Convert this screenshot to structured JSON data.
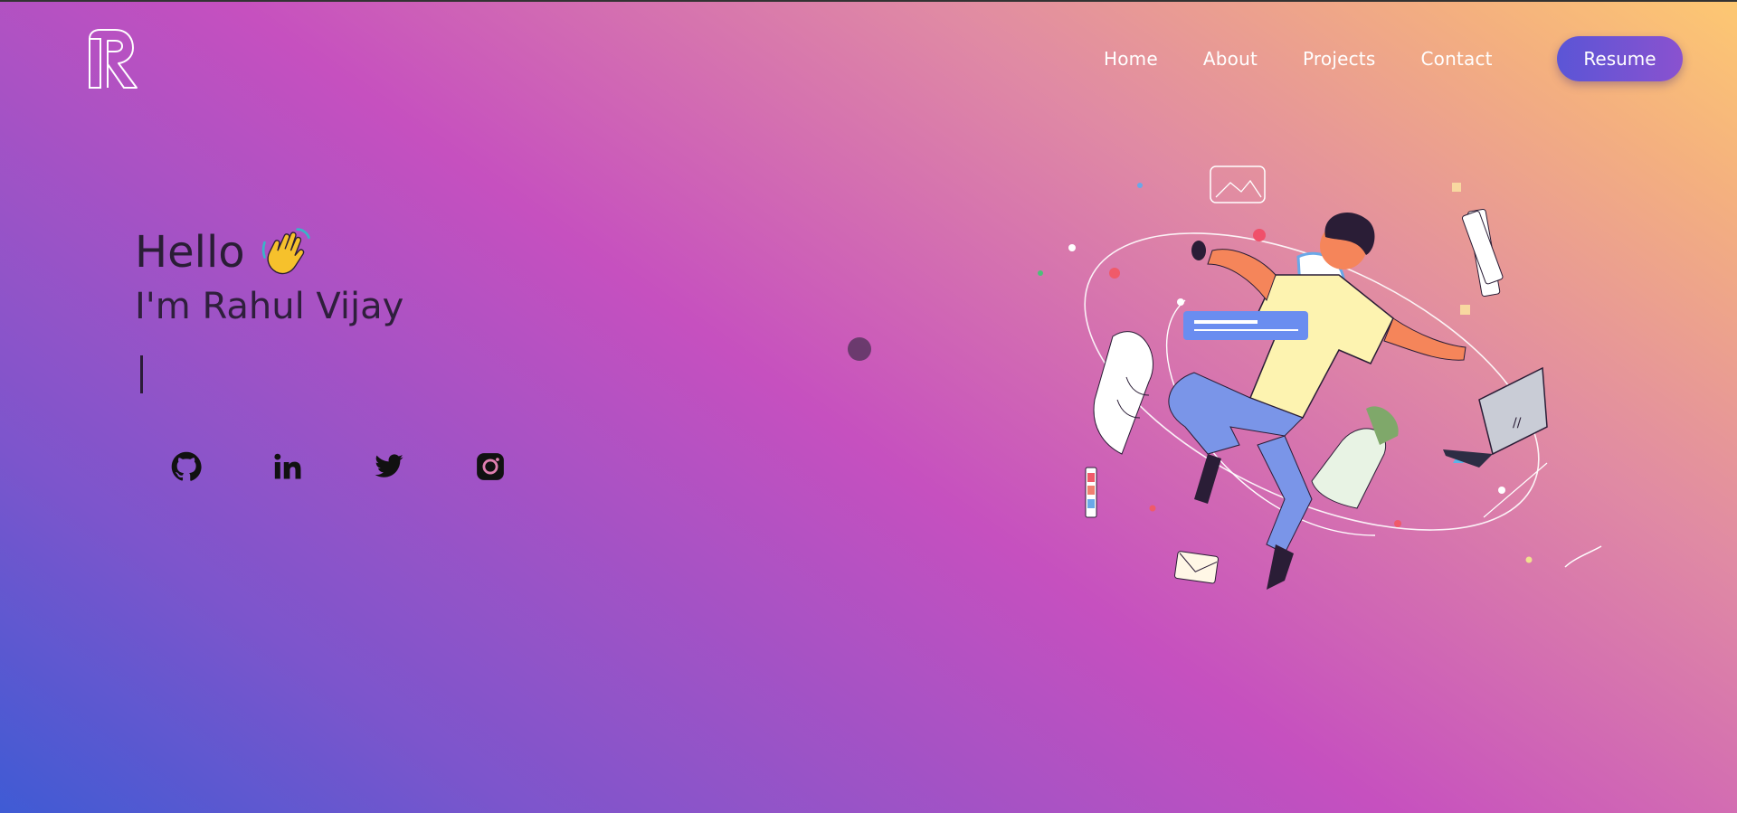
{
  "nav": {
    "links": [
      "Home",
      "About",
      "Projects",
      "Contact"
    ],
    "resume_label": "Resume"
  },
  "hero": {
    "greeting": "Hello",
    "name_line": "I'm Rahul Vijay"
  },
  "socials": [
    "github-icon",
    "linkedin-icon",
    "twitter-icon",
    "instagram-icon"
  ],
  "colors": {
    "gradient_start": "#3f5bd4",
    "gradient_mid": "#c650bf",
    "gradient_end": "#fdc872",
    "resume_button": "#6a54d4",
    "text_dark": "#2a1d36"
  }
}
